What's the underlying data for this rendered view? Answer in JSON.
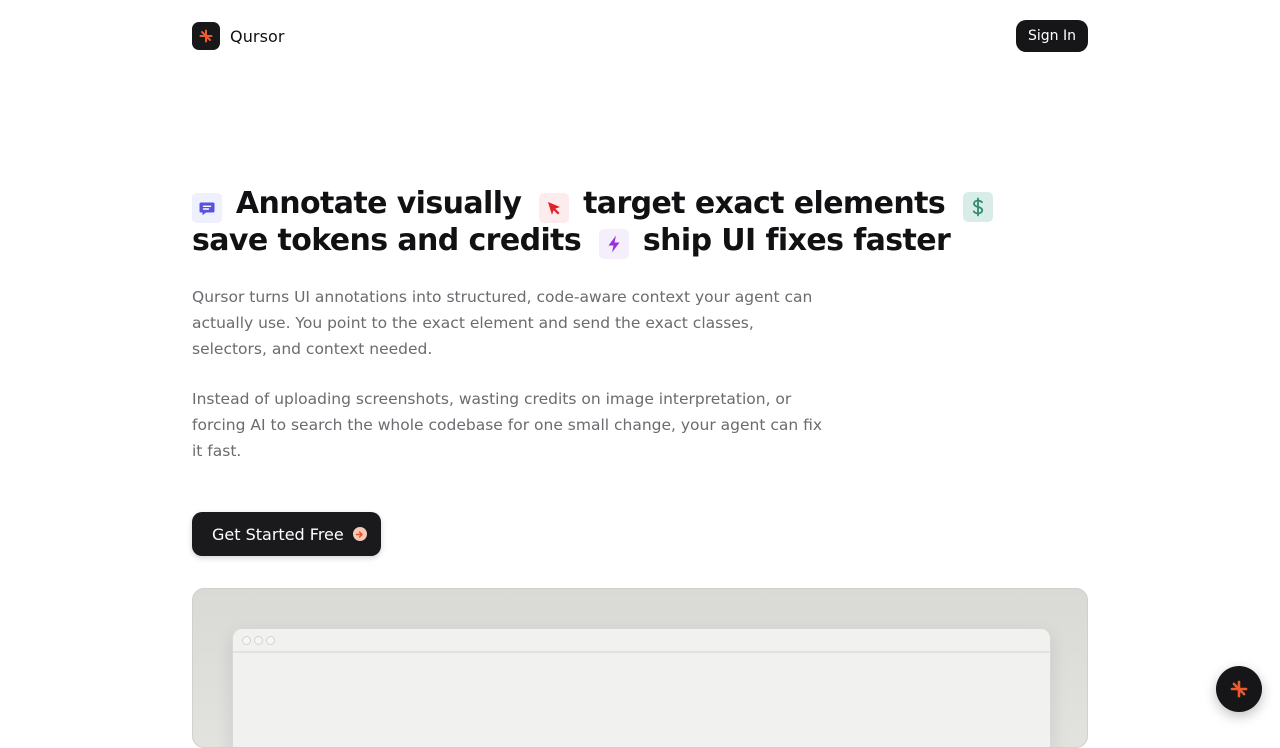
{
  "header": {
    "brand_name": "Qursor",
    "logo_icon": "asterisk-logo-icon",
    "sign_in_label": "Sign In"
  },
  "hero": {
    "headline": {
      "icons": {
        "annotate": "chat-bubble-icon",
        "target": "cursor-arrow-icon",
        "save": "dollar-icon",
        "ship": "lightning-bolt-icon"
      },
      "part1": "Annotate visually",
      "part2": "target exact elements",
      "part3": "save tokens and credits",
      "part4": "ship UI fixes faster"
    },
    "paragraph1": "Qursor turns UI annotations into structured, code-aware context your agent can actually use. You point to the exact element and send the exact classes, selectors, and context needed.",
    "paragraph2": "Instead of uploading screenshots, wasting credits on image interpretation, or forcing AI to search the whole codebase for one small change, your agent can fix it fast.",
    "cta_label": "Get Started Free",
    "cta_icon": "arrow-right-circle-icon"
  },
  "floating_button": {
    "icon": "asterisk-logo-icon"
  },
  "colors": {
    "accent_orange": "#e8532a",
    "dark": "#161618",
    "chat_icon": "#5b50e0",
    "cursor_icon": "#e0202a",
    "dollar_icon": "#2f8a6e",
    "bolt_icon": "#9b2ee0"
  }
}
